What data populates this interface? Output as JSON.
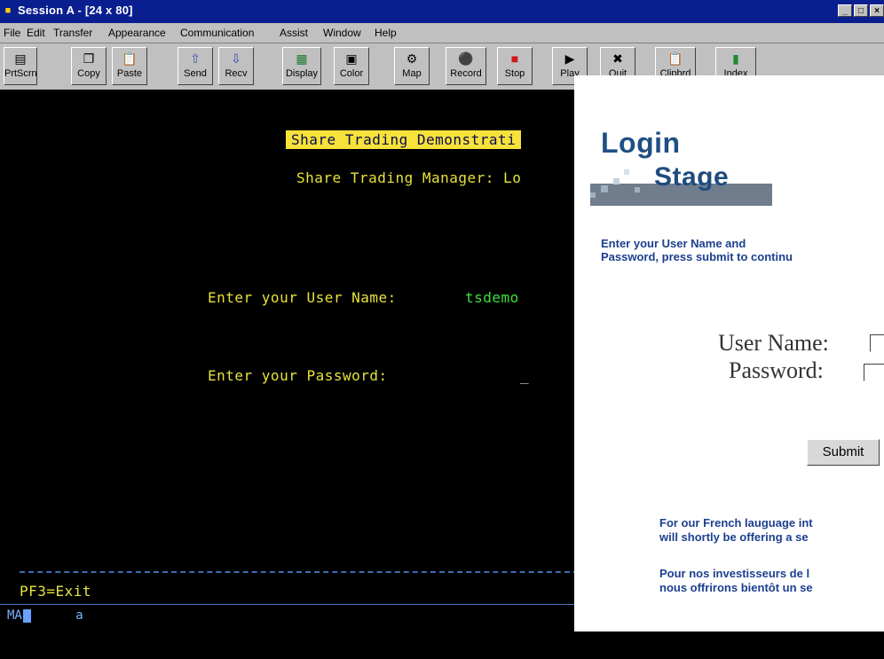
{
  "window": {
    "title": "Session A - [24 x 80]",
    "controls": [
      "_",
      "□",
      "×"
    ]
  },
  "menu": [
    "File",
    "Edit",
    "Transfer",
    "Appearance",
    "Communication",
    "Assist",
    "Window",
    "Help"
  ],
  "toolbar": [
    {
      "label": "PrtScrn",
      "icon": "print-screen-icon"
    },
    {
      "label": "Copy",
      "icon": "copy-icon"
    },
    {
      "label": "Paste",
      "icon": "paste-icon"
    },
    {
      "label": "Send",
      "icon": "send-icon"
    },
    {
      "label": "Recv",
      "icon": "receive-icon"
    },
    {
      "label": "Display",
      "icon": "display-icon"
    },
    {
      "label": "Color",
      "icon": "color-icon"
    },
    {
      "label": "Map",
      "icon": "map-icon"
    },
    {
      "label": "Record",
      "icon": "record-icon"
    },
    {
      "label": "Stop",
      "icon": "stop-icon"
    },
    {
      "label": "Play",
      "icon": "play-icon"
    },
    {
      "label": "Quit",
      "icon": "quit-icon"
    },
    {
      "label": "Clipbrd",
      "icon": "clipboard-icon"
    },
    {
      "label": "Index",
      "icon": "index-icon"
    }
  ],
  "terminal": {
    "banner": "Share Trading Demonstrati",
    "subtitle": "Share Trading Manager: Lo",
    "username_label": "Enter your User Name:",
    "username_value": "tsdemo",
    "password_label": "Enter your Password:",
    "password_cursor": "_",
    "pf_keys": "PF3=Exit",
    "oia_session": "MA",
    "oia_indicator": "a"
  },
  "web": {
    "logo_top": "Login",
    "logo_bottom": "Stage",
    "instruction_line1": "Enter your User Name and",
    "instruction_line2": "Password, press submit to continu",
    "username_label": "User Name:",
    "password_label": "Password:",
    "submit_label": "Submit",
    "english_line1": "For our French lauguage int",
    "english_line2": "will shortly be offering a se",
    "french_line1": "Pour nos investisseurs de l",
    "french_line2": "nous offrirons bientôt un se"
  }
}
